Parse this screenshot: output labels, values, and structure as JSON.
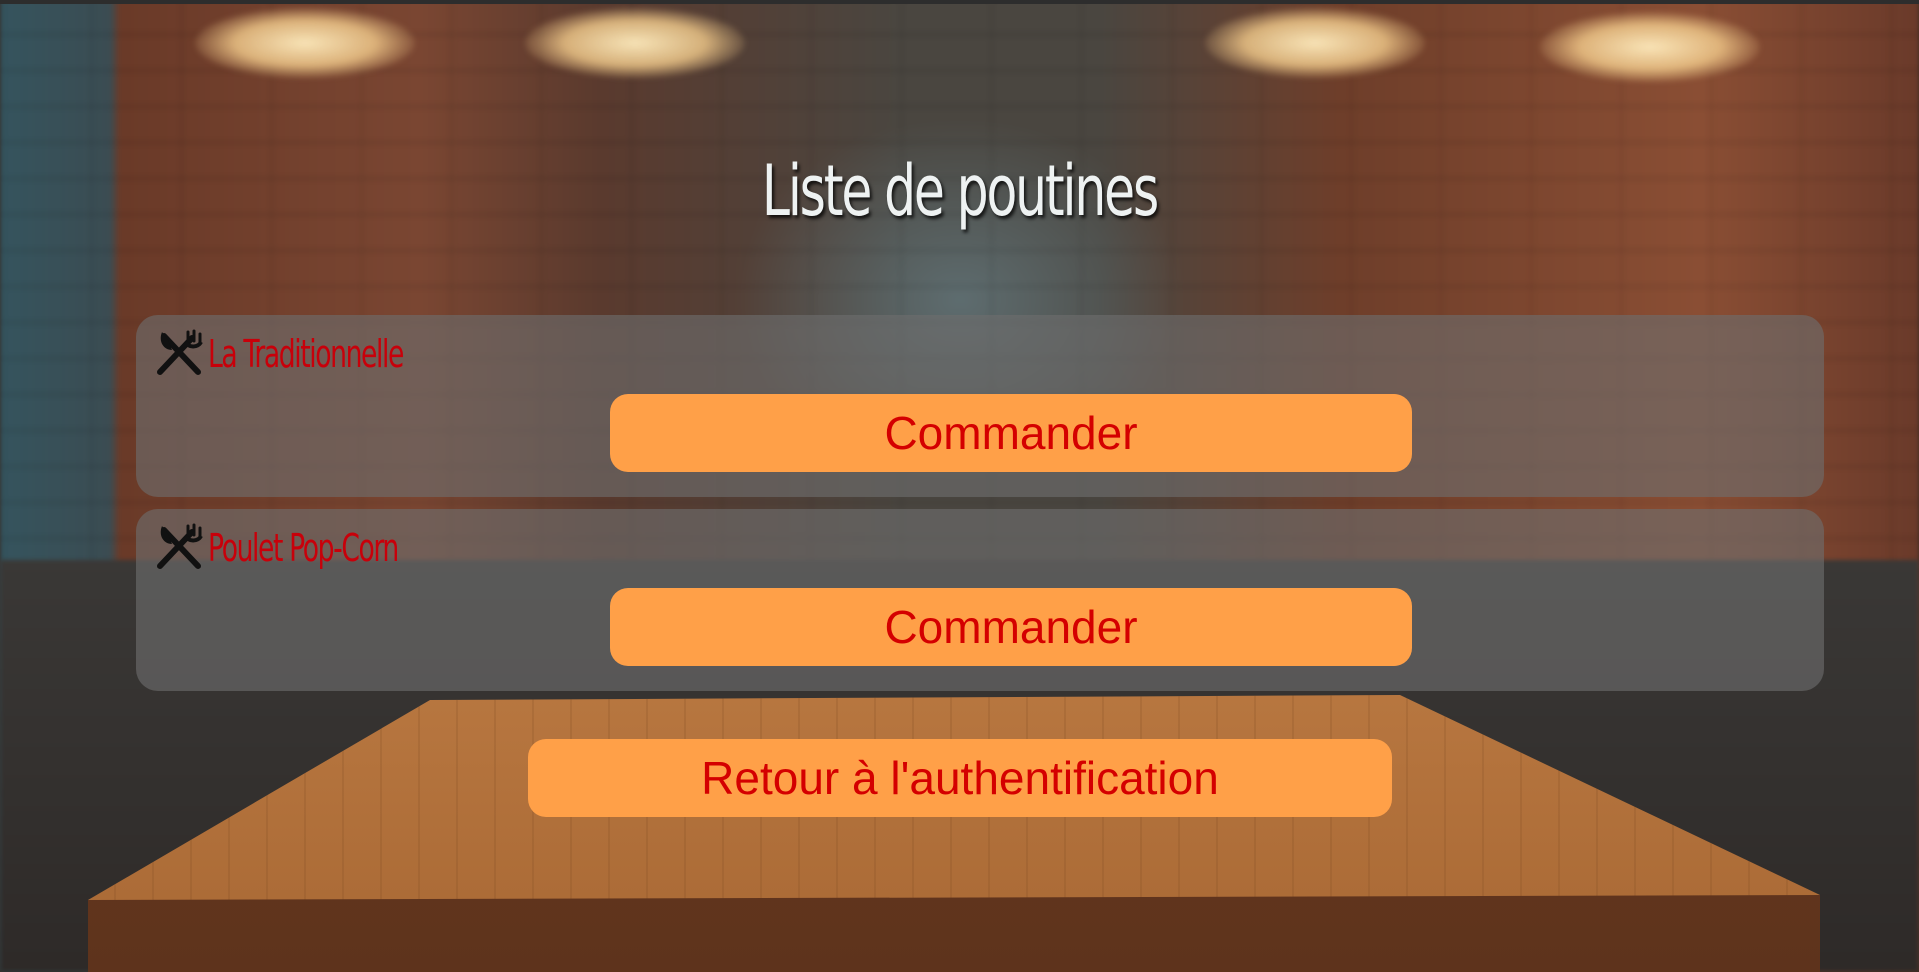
{
  "page": {
    "title": "Liste de poutines"
  },
  "poutines": [
    {
      "name": "La Traditionnelle",
      "icon": "utensils-icon",
      "order_label": "Commander"
    },
    {
      "name": "Poulet Pop-Corn",
      "icon": "utensils-icon",
      "order_label": "Commander"
    }
  ],
  "footer": {
    "back_label": "Retour à l'authentification"
  },
  "colors": {
    "button_bg": "#ffa048",
    "button_text": "#d40000",
    "item_name": "#c8000a",
    "card_bg": "rgba(110,110,110,0.62)",
    "title_text": "#eef2f2"
  }
}
